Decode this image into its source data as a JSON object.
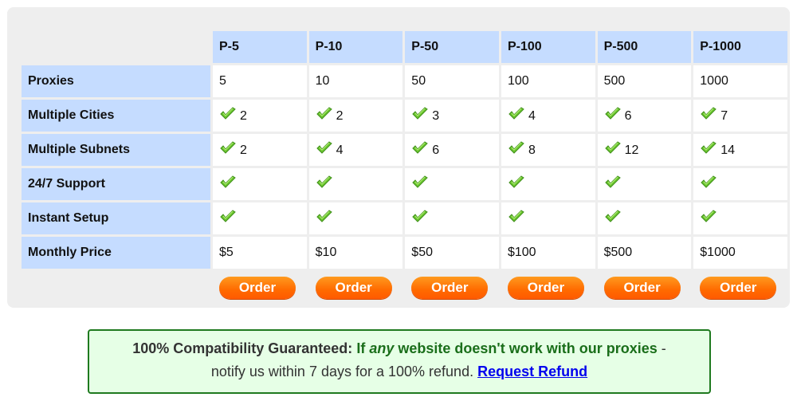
{
  "plans": [
    {
      "name": "P-5",
      "proxies": "5",
      "cities": "2",
      "subnets": "2",
      "support": true,
      "setup": true,
      "price": "$5",
      "order_label": "Order"
    },
    {
      "name": "P-10",
      "proxies": "10",
      "cities": "2",
      "subnets": "4",
      "support": true,
      "setup": true,
      "price": "$10",
      "order_label": "Order"
    },
    {
      "name": "P-50",
      "proxies": "50",
      "cities": "3",
      "subnets": "6",
      "support": true,
      "setup": true,
      "price": "$50",
      "order_label": "Order"
    },
    {
      "name": "P-100",
      "proxies": "100",
      "cities": "4",
      "subnets": "8",
      "support": true,
      "setup": true,
      "price": "$100",
      "order_label": "Order"
    },
    {
      "name": "P-500",
      "proxies": "500",
      "cities": "6",
      "subnets": "12",
      "support": true,
      "setup": true,
      "price": "$500",
      "order_label": "Order"
    },
    {
      "name": "P-1000",
      "proxies": "1000",
      "cities": "7",
      "subnets": "14",
      "support": true,
      "setup": true,
      "price": "$1000",
      "order_label": "Order"
    }
  ],
  "row_labels": {
    "proxies": "Proxies",
    "cities": "Multiple Cities",
    "subnets": "Multiple Subnets",
    "support": "24/7 Support",
    "setup": "Instant Setup",
    "price": "Monthly Price"
  },
  "icons": {
    "check": "green-checkmark-icon"
  },
  "colors": {
    "header_bg": "#c5dcff",
    "order_button": "#ff6a00",
    "guarantee_bg": "#e6ffe6",
    "guarantee_border": "#1f7a1f",
    "link": "#0000ee"
  },
  "guarantee": {
    "title": "100% Compatibility Guaranteed:",
    "green_pre": "If",
    "green_em": "any",
    "green_post": "website doesn't work with our proxies",
    "dash": "-",
    "line2": "notify us within 7 days for a 100% refund.",
    "link_label": "Request Refund"
  }
}
